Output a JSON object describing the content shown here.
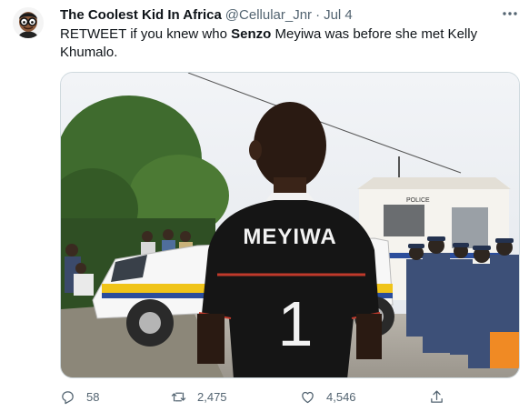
{
  "tweet": {
    "display_name": "The Coolest Kid In Africa",
    "handle": "@Cellular_Jnr",
    "separator": "·",
    "date": "Jul 4",
    "text_before": "RETWEET if you knew who ",
    "text_bold": "Senzo",
    "text_after": " Meyiwa was before she met Kelly Khumalo.",
    "more_icon": "more-horizontal-icon"
  },
  "media": {
    "jersey_name": "MEYIWA",
    "jersey_number": "1",
    "building_sign": "POLICE"
  },
  "actions": {
    "replies": "58",
    "retweets": "2,475",
    "likes": "4,546",
    "icons": [
      "reply-icon",
      "retweet-icon",
      "like-icon",
      "share-icon"
    ]
  },
  "colors": {
    "text_primary": "#0f1419",
    "text_secondary": "#536471",
    "border": "#cfd9de"
  }
}
